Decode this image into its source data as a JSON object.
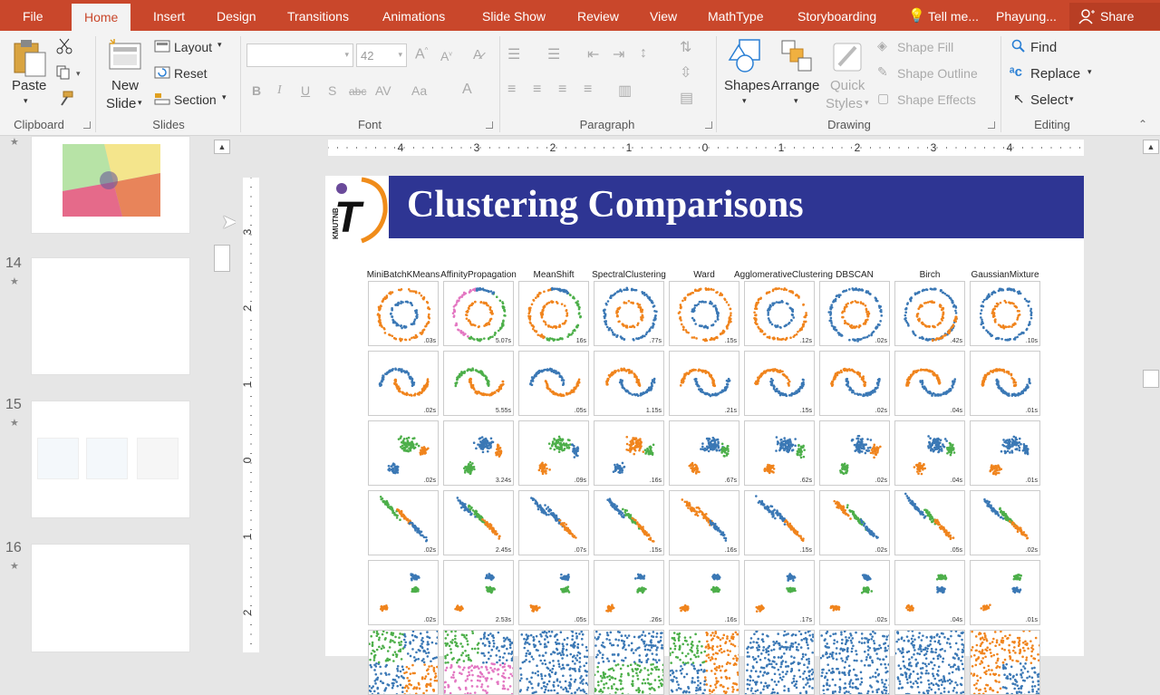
{
  "tabs": [
    "File",
    "Home",
    "Insert",
    "Design",
    "Transitions",
    "Animations",
    "Slide Show",
    "Review",
    "View",
    "MathType",
    "Storyboarding",
    "Tell me...",
    "Phayung...",
    "Share"
  ],
  "ribbon": {
    "clipboard": {
      "paste": "Paste",
      "label": "Clipboard"
    },
    "slides": {
      "new_slide_1": "New",
      "new_slide_2": "Slide",
      "layout": "Layout",
      "reset": "Reset",
      "section": "Section",
      "label": "Slides"
    },
    "font": {
      "font_name": "",
      "font_size": "42",
      "label": "Font"
    },
    "paragraph": {
      "label": "Paragraph"
    },
    "drawing": {
      "shapes": "Shapes",
      "arrange": "Arrange",
      "quick_styles_1": "Quick",
      "quick_styles_2": "Styles",
      "shape_fill": "Shape Fill",
      "shape_outline": "Shape Outline",
      "shape_effects": "Shape Effects",
      "label": "Drawing"
    },
    "editing": {
      "find": "Find",
      "replace": "Replace",
      "select": "Select",
      "label": "Editing"
    }
  },
  "slides_pane": {
    "numbers": [
      "14",
      "15",
      "16"
    ]
  },
  "ruler": {
    "h": [
      "4",
      "3",
      "2",
      "1",
      "0",
      "1",
      "2",
      "3",
      "4"
    ],
    "v": [
      "3",
      "2",
      "1",
      "0",
      "1",
      "2"
    ]
  },
  "slide": {
    "logo_text": "KMUTNB",
    "logo_letter": "T",
    "title": "Clustering Comparisons",
    "algorithms": [
      "MiniBatchKMeans",
      "AffinityPropagation",
      "MeanShift",
      "SpectralClustering",
      "Ward",
      "AgglomerativeClustering",
      "DBSCAN",
      "Birch",
      "GaussianMixture"
    ],
    "times": [
      [
        ".03s",
        "5.07s",
        "16s",
        ".77s",
        ".15s",
        ".12s",
        ".02s",
        ".42s",
        ".10s"
      ],
      [
        ".02s",
        "5.55s",
        ".05s",
        "1.15s",
        ".21s",
        ".15s",
        ".02s",
        ".04s",
        ".01s"
      ],
      [
        ".02s",
        "3.24s",
        ".09s",
        ".16s",
        ".67s",
        ".62s",
        ".02s",
        ".04s",
        ".01s"
      ],
      [
        ".02s",
        "2.45s",
        ".07s",
        ".15s",
        ".16s",
        ".15s",
        ".02s",
        ".05s",
        ".02s"
      ],
      [
        ".02s",
        "2.53s",
        ".05s",
        ".26s",
        ".16s",
        ".17s",
        ".02s",
        ".04s",
        ".01s"
      ]
    ]
  },
  "colors": {
    "tab_bar": "#c9472b",
    "title_bar": "#2e3593",
    "blue": "#3b78b5",
    "orange": "#f0841d",
    "green": "#4daf4a",
    "pink": "#e377c2"
  }
}
